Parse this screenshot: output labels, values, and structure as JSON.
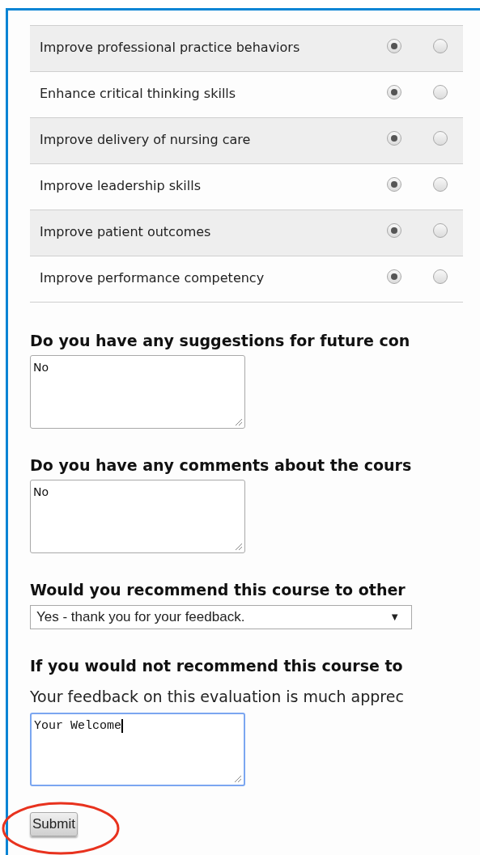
{
  "rating_rows": [
    {
      "label": "Improve professional practice behaviors",
      "options": [
        {
          "selected": true
        },
        {
          "selected": false
        }
      ]
    },
    {
      "label": "Enhance critical thinking skills",
      "options": [
        {
          "selected": true
        },
        {
          "selected": false
        }
      ]
    },
    {
      "label": "Improve delivery of nursing care",
      "options": [
        {
          "selected": true
        },
        {
          "selected": false
        }
      ]
    },
    {
      "label": "Improve leadership skills",
      "options": [
        {
          "selected": true
        },
        {
          "selected": false
        }
      ]
    },
    {
      "label": "Improve patient outcomes",
      "options": [
        {
          "selected": true
        },
        {
          "selected": false
        }
      ]
    },
    {
      "label": "Improve performance competency",
      "options": [
        {
          "selected": true
        },
        {
          "selected": false
        }
      ]
    }
  ],
  "questions": [
    {
      "kind": "textarea",
      "heading": "Do you have any suggestions for future con",
      "value": "No",
      "focused": false
    },
    {
      "kind": "textarea",
      "heading": "Do you have any comments about the cours",
      "value": "No",
      "focused": false
    },
    {
      "kind": "select",
      "heading": "Would you recommend this course to other",
      "value": "Yes - thank you for your feedback.",
      "arrow": "▼"
    },
    {
      "kind": "textarea",
      "heading": "If you would not recommend this course to",
      "note": "Your feedback on this evaluation is much apprec",
      "value": "Your Welcome",
      "focused": true
    }
  ],
  "submit_button": "Submit"
}
